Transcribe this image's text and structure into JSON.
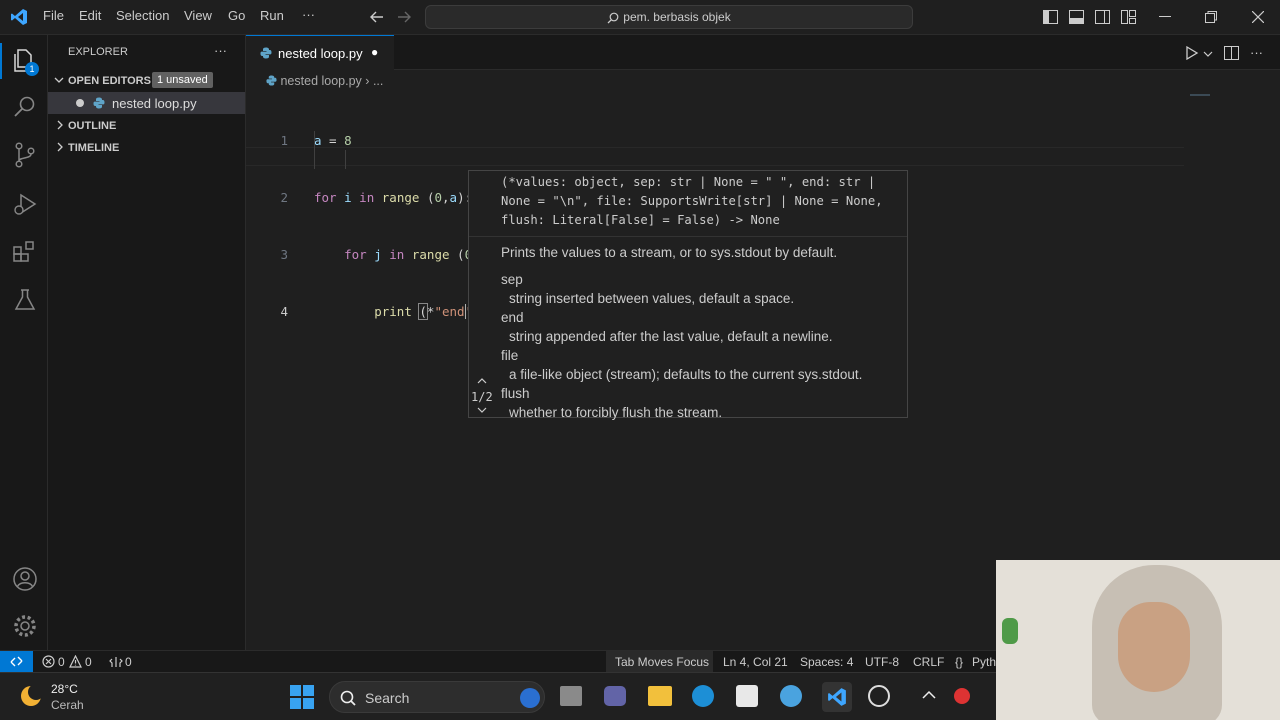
{
  "menu": {
    "file": "File",
    "edit": "Edit",
    "selection": "Selection",
    "view": "View",
    "go": "Go",
    "run": "Run",
    "more": "···"
  },
  "search": {
    "text": "pem. berbasis objek"
  },
  "explorer": {
    "title": "EXPLORER",
    "more": "···",
    "open_editors": "OPEN EDITORS",
    "unsaved_badge": "1 unsaved",
    "open_file": "nested loop.py",
    "outline": "OUTLINE",
    "timeline": "TIMELINE"
  },
  "activity": {
    "explorer_badge": "1"
  },
  "tab": {
    "label": "nested loop.py",
    "dirty": "●"
  },
  "breadcrumb": {
    "file": "nested loop.py",
    "sep": "›",
    "more": "..."
  },
  "code": {
    "line_numbers": [
      "1",
      "2",
      "3",
      "4"
    ]
  },
  "hover": {
    "signature_lines": [
      "(*values: object, sep: str | None = \" \", end: str |",
      "None = \"\\n\", file: SupportsWrite[str] | None = None,",
      "flush: Literal[False] = False) -> None"
    ],
    "description": "Prints the values to a stream, or to sys.stdout by default.",
    "params": [
      {
        "name": "sep",
        "desc": "string inserted between values, default a space."
      },
      {
        "name": "end",
        "desc": "string appended after the last value, default a newline."
      },
      {
        "name": "file",
        "desc": "a file-like object (stream); defaults to the current sys.stdout."
      },
      {
        "name": "flush",
        "desc": "whether to forcibly flush the stream."
      }
    ],
    "overload": "1/2"
  },
  "status": {
    "errors": "0",
    "warnings": "0",
    "ports": "0",
    "tab_focus": "Tab Moves Focus",
    "position": "Ln 4, Col 21",
    "spaces": "Spaces: 4",
    "encoding": "UTF-8",
    "eol": "CRLF",
    "language": "Pyth"
  },
  "taskbar": {
    "temp": "28°C",
    "weather": "Cerah",
    "search": "Search"
  },
  "colors": {
    "accent": "#0078d4",
    "bg": "#1f1f1f",
    "sidebar": "#181818",
    "status_remote": "#0078d4"
  }
}
